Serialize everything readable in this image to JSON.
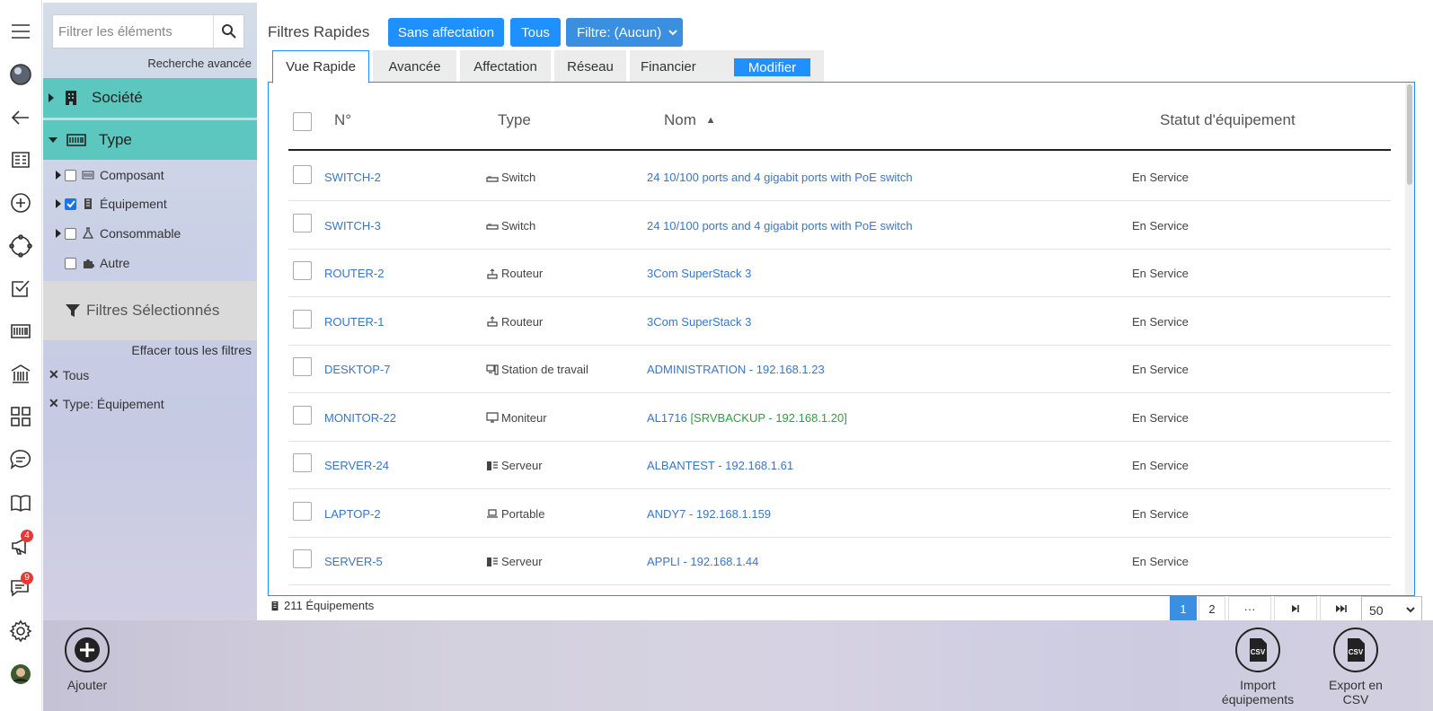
{
  "sidebar_icons": [
    "menu-icon",
    "globe-icon",
    "back-arrow-icon",
    "receipt-icon",
    "add-circle-icon",
    "cycle-icon",
    "checklist-icon",
    "barcode-icon",
    "bank-icon",
    "apps-grid-icon",
    "chat-bubble-icon",
    "book-icon",
    "megaphone-icon",
    "messages-icon",
    "settings-icon",
    "avatar"
  ],
  "badges": {
    "megaphone": "4",
    "messages": "9"
  },
  "filter_panel": {
    "search_placeholder": "Filtrer les éléments",
    "advanced_search": "Recherche avancée",
    "groups": {
      "company": "Société",
      "type": "Type"
    },
    "type_items": [
      {
        "label": "Composant",
        "checked": false
      },
      {
        "label": "Équipement",
        "checked": true
      },
      {
        "label": "Consommable",
        "checked": false
      },
      {
        "label": "Autre",
        "checked": false
      }
    ],
    "selected_filters_title": "Filtres Sélectionnés",
    "clear_all": "Effacer tous les filtres",
    "active_filters": [
      "Tous",
      "Type: Équipement"
    ]
  },
  "quick_filters": {
    "label": "Filtres Rapides",
    "unassigned": "Sans affectation",
    "all": "Tous",
    "filter_dropdown": "Filtre: (Aucun)"
  },
  "tabs": {
    "items": [
      "Vue Rapide",
      "Avancée",
      "Affectation",
      "Réseau",
      "Financier"
    ],
    "active": "Vue Rapide",
    "modify": "Modifier"
  },
  "table": {
    "headers": {
      "number": "N°",
      "type": "Type",
      "name": "Nom",
      "status": "Statut d'équipement"
    },
    "sort_indicator": "▲",
    "rows": [
      {
        "number": "SWITCH-2",
        "type": "Switch",
        "type_icon": "switch-icon",
        "name": "24 10/100 ports and 4 gigabit ports with PoE switch",
        "name_suffix": "",
        "status": "En Service"
      },
      {
        "number": "SWITCH-3",
        "type": "Switch",
        "type_icon": "switch-icon",
        "name": "24 10/100 ports and 4 gigabit ports with PoE switch",
        "name_suffix": "",
        "status": "En Service"
      },
      {
        "number": "ROUTER-2",
        "type": "Routeur",
        "type_icon": "router-icon",
        "name": "3Com SuperStack 3",
        "name_suffix": "",
        "status": "En Service"
      },
      {
        "number": "ROUTER-1",
        "type": "Routeur",
        "type_icon": "router-icon",
        "name": "3Com SuperStack 3",
        "name_suffix": "",
        "status": "En Service"
      },
      {
        "number": "DESKTOP-7",
        "type": "Station de travail",
        "type_icon": "workstation-icon",
        "name": "ADMINISTRATION - 192.168.1.23",
        "name_suffix": "",
        "status": "En Service"
      },
      {
        "number": "MONITOR-22",
        "type": "Moniteur",
        "type_icon": "monitor-icon",
        "name": "AL1716 ",
        "name_suffix": "[SRVBACKUP - 192.168.1.20]",
        "status": "En Service"
      },
      {
        "number": "SERVER-24",
        "type": "Serveur",
        "type_icon": "server-icon",
        "name": "ALBANTEST - 192.168.1.61",
        "name_suffix": "",
        "status": "En Service"
      },
      {
        "number": "LAPTOP-2",
        "type": "Portable",
        "type_icon": "laptop-icon",
        "name": "ANDY7 - 192.168.1.159",
        "name_suffix": "",
        "status": "En Service"
      },
      {
        "number": "SERVER-5",
        "type": "Serveur",
        "type_icon": "server-icon",
        "name": "APPLI - 192.168.1.44",
        "name_suffix": "",
        "status": "En Service"
      }
    ]
  },
  "footer": {
    "count": "211 Équipements",
    "pages": [
      "1",
      "2",
      "···"
    ],
    "current_page": "1",
    "page_size": "50"
  },
  "actions": {
    "add": "Ajouter",
    "import_line1": "Import",
    "import_line2": "équipements",
    "export_line1": "Export en",
    "export_line2": "CSV",
    "csv_badge": "CSV"
  },
  "colors": {
    "accent": "#1e90ff",
    "teal": "#5cc7bf",
    "link": "#3a76c8",
    "green": "#2f9e44"
  }
}
